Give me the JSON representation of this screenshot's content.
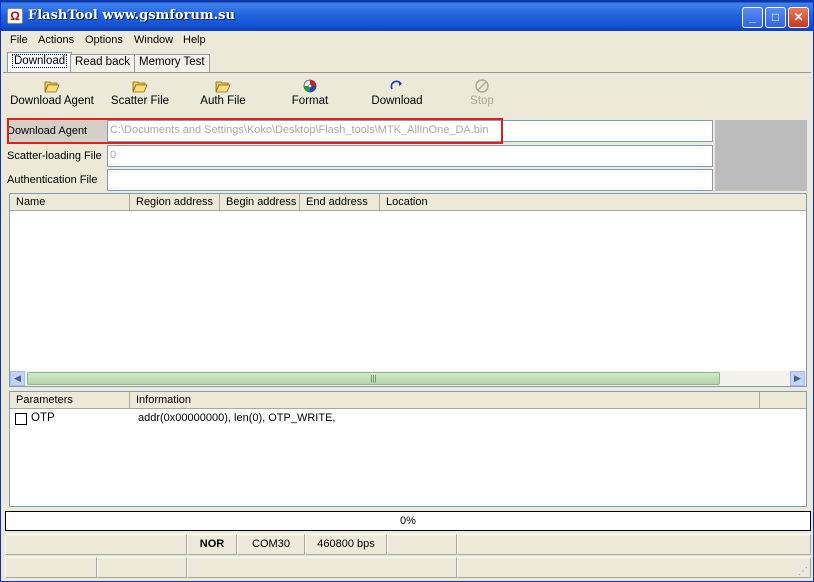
{
  "window": {
    "title": "FlashTool www.gsmforum.su"
  },
  "menu": [
    "File",
    "Actions",
    "Options",
    "Window",
    "Help"
  ],
  "tabs": [
    "Download",
    "Read back",
    "Memory Test"
  ],
  "toolbar": [
    {
      "label": "Download Agent",
      "icon": "folder-open-icon",
      "enabled": true
    },
    {
      "label": "Scatter File",
      "icon": "folder-open-icon",
      "enabled": true
    },
    {
      "label": "Auth File",
      "icon": "folder-open-icon",
      "enabled": true
    },
    {
      "label": "Format",
      "icon": "format-icon",
      "enabled": true
    },
    {
      "label": "Download",
      "icon": "download-arrow-icon",
      "enabled": true
    },
    {
      "label": "Stop",
      "icon": "stop-icon",
      "enabled": false
    }
  ],
  "fields": {
    "download_agent": {
      "label": "Download Agent",
      "value": "C:\\Documents and Settings\\Koko\\Desktop\\Flash_tools\\MTK_AllInOne_DA.bin"
    },
    "scatter": {
      "label": "Scatter-loading File",
      "value": "0"
    },
    "auth": {
      "label": "Authentication File",
      "value": ""
    }
  },
  "region_table": {
    "columns": [
      "Name",
      "Region address",
      "Begin address",
      "End address",
      "Location"
    ],
    "rows": []
  },
  "param_table": {
    "columns": [
      "Parameters",
      "Information"
    ],
    "rows": [
      {
        "name": "OTP",
        "checked": false,
        "info": "addr(0x00000000), len(0), OTP_WRITE,"
      }
    ]
  },
  "progress": {
    "text": "0%",
    "value": 0
  },
  "status": {
    "flash_type": "NOR",
    "port": "COM30",
    "baud": "460800 bps"
  },
  "colors": {
    "title_bar": "#2463de",
    "highlight": "#e02020",
    "scroll_thumb": "#b3d6a8"
  }
}
